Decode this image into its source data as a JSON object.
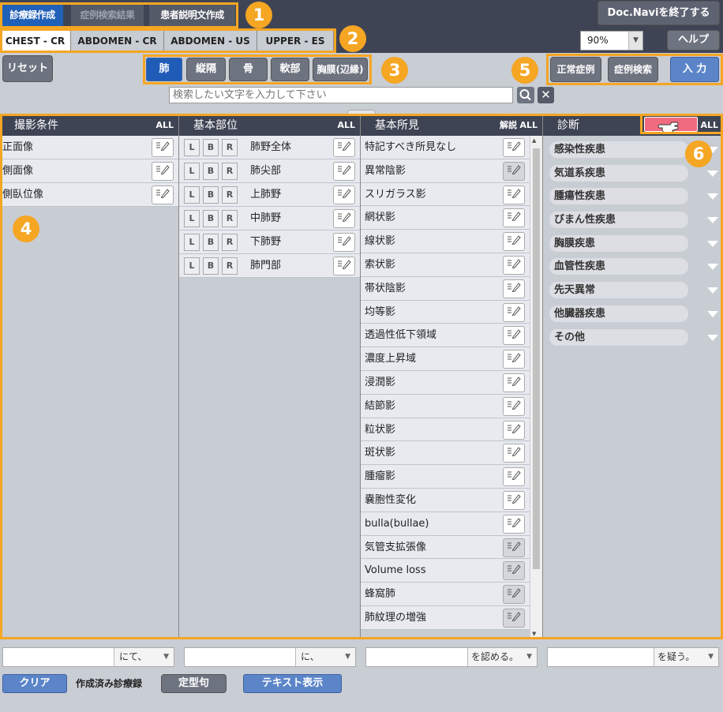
{
  "top_tabs": [
    "診療録作成",
    "症例検索結果",
    "患者説明文作成"
  ],
  "exit_button": "Doc.Naviを終了する",
  "modality_tabs": [
    "CHEST - CR",
    "ABDOMEN - CR",
    "ABDOMEN - US",
    "UPPER - ES"
  ],
  "zoom": "90%",
  "help_button": "ヘルプ",
  "reset_button": "リセット",
  "organ_tabs": [
    "肺",
    "縦隔",
    "骨",
    "軟部",
    "胸膜(辺縁)"
  ],
  "search": {
    "placeholder": "検索したい文字を入力して下さい"
  },
  "right_buttons": {
    "normal": "正常症例",
    "case_search": "症例検索",
    "input": "入 力"
  },
  "badges": [
    "1",
    "2",
    "3",
    "4",
    "5",
    "6"
  ],
  "panels": {
    "conditions": {
      "title": "撮影条件",
      "all": "ALL",
      "items": [
        "正面像",
        "側面像",
        "側臥位像"
      ]
    },
    "region": {
      "title": "基本部位",
      "all": "ALL",
      "lbr": [
        "L",
        "B",
        "R"
      ],
      "items": [
        "肺野全体",
        "肺尖部",
        "上肺野",
        "中肺野",
        "下肺野",
        "肺門部"
      ]
    },
    "findings": {
      "title": "基本所見",
      "explain": "解説",
      "all": "ALL",
      "items": [
        "特記すべき所見なし",
        "異常陰影",
        "スリガラス影",
        "網状影",
        "線状影",
        "索状影",
        "帯状陰影",
        "均等影",
        "透過性低下領域",
        "濃度上昇域",
        "浸潤影",
        "結節影",
        "粒状影",
        "斑状影",
        "腫瘤影",
        "嚢胞性変化",
        "bulla(bullae)",
        "気管支拡張像",
        "Volume loss",
        "蜂窩肺",
        "肺紋理の増強"
      ]
    },
    "diagnosis": {
      "title": "診断",
      "all": "ALL",
      "items": [
        "感染性疾患",
        "気道系疾患",
        "腫瘍性疾患",
        "びまん性疾患",
        "胸膜疾患",
        "血管性疾患",
        "先天異常",
        "他臓器疾患",
        "その他"
      ]
    }
  },
  "bottom_combos": [
    "にて、",
    "に、",
    "を認める。",
    "を疑う。"
  ],
  "bottom_bar": {
    "clear": "クリア",
    "label": "作成済み診療録",
    "template": "定型句",
    "text_view": "テキスト表示"
  }
}
